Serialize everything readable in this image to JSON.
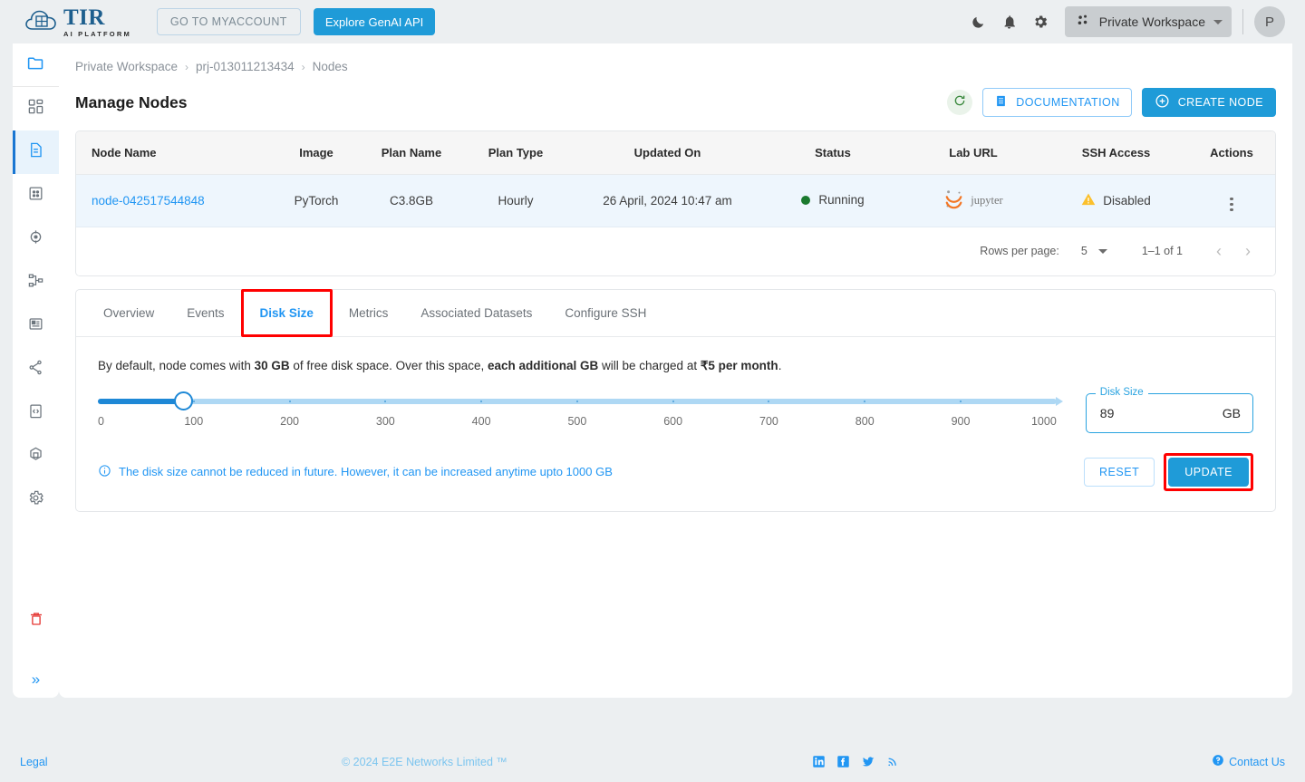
{
  "topbar": {
    "logo_title": "TIR",
    "logo_subtitle": "AI PLATFORM",
    "myaccount_label": "GO TO MYACCOUNT",
    "genai_label": "Explore GenAI API",
    "icons": [
      "dark-mode-icon",
      "notifications-icon",
      "settings-icon"
    ],
    "workspace_label": "Private Workspace",
    "avatar_initial": "P"
  },
  "sidebar": {
    "items": [
      {
        "name": "folder-icon",
        "label": "Folder"
      },
      {
        "name": "dashboard-icon",
        "label": "Dashboard"
      },
      {
        "name": "nodes-icon",
        "label": "Nodes"
      },
      {
        "name": "datasets-icon",
        "label": "Datasets"
      },
      {
        "name": "inference-icon",
        "label": "Inference"
      },
      {
        "name": "pipelines-icon",
        "label": "Pipelines"
      },
      {
        "name": "containers-icon",
        "label": "Containers"
      },
      {
        "name": "api-icon",
        "label": "API Tokens"
      },
      {
        "name": "code-icon",
        "label": "Code"
      },
      {
        "name": "models-icon",
        "label": "Models"
      },
      {
        "name": "settings-icon",
        "label": "Settings"
      }
    ],
    "trash": "delete-icon",
    "expand": "»"
  },
  "breadcrumb": {
    "items": [
      "Private Workspace",
      "prj-013011213434",
      "Nodes"
    ],
    "separator": "›"
  },
  "header": {
    "title": "Manage Nodes",
    "refresh_label": "refresh-icon",
    "documentation_label": "DOCUMENTATION",
    "create_node_label": "CREATE NODE"
  },
  "table": {
    "columns": [
      "Node Name",
      "Image",
      "Plan Name",
      "Plan Type",
      "Updated On",
      "Status",
      "Lab URL",
      "SSH Access",
      "Actions"
    ],
    "rows": [
      {
        "node_name": "node-042517544848",
        "image": "PyTorch",
        "plan_name": "C3.8GB",
        "plan_type": "Hourly",
        "updated_on": "26 April, 2024 10:47 am",
        "status": "Running",
        "status_color": "#1b7a2f",
        "lab_url": "jupyter",
        "ssh_access": "Disabled",
        "ssh_color": "#fbc02d"
      }
    ],
    "pagination": {
      "rows_per_page_label": "Rows per page:",
      "rows_per_page_value": "5",
      "range_label": "1–1 of 1",
      "prev": "‹",
      "next": "›"
    }
  },
  "tabs": {
    "items": [
      "Overview",
      "Events",
      "Disk Size",
      "Metrics",
      "Associated Datasets",
      "Configure SSH"
    ],
    "active": "Disk Size",
    "highlight_color": "#ff0000"
  },
  "disk": {
    "description_parts": [
      {
        "t": "By default, node comes with ",
        "b": false
      },
      {
        "t": "30 GB",
        "b": true
      },
      {
        "t": " of free disk space. Over this space, ",
        "b": false
      },
      {
        "t": "each additional GB",
        "b": true
      },
      {
        "t": " will be charged at ",
        "b": false
      },
      {
        "t": "₹5 per month",
        "b": true
      },
      {
        "t": ".",
        "b": false
      }
    ],
    "slider": {
      "min": 0,
      "max": 1000,
      "value": 89,
      "tick_labels": [
        "0",
        "100",
        "200",
        "300",
        "400",
        "500",
        "600",
        "700",
        "800",
        "900",
        "1000"
      ],
      "fill_color": "#1e88d6",
      "track_color": "#aed8f4"
    },
    "field": {
      "legend": "Disk Size",
      "value": "89",
      "unit": "GB"
    },
    "note": "The disk size cannot be reduced in future. However, it can be increased anytime upto 1000 GB",
    "reset_label": "RESET",
    "update_label": "UPDATE"
  },
  "footer": {
    "legal": "Legal",
    "copyright": "© 2024 E2E Networks Limited ™",
    "social": [
      "linkedin-icon",
      "facebook-icon",
      "twitter-icon",
      "rss-icon"
    ],
    "contact": "Contact Us"
  }
}
